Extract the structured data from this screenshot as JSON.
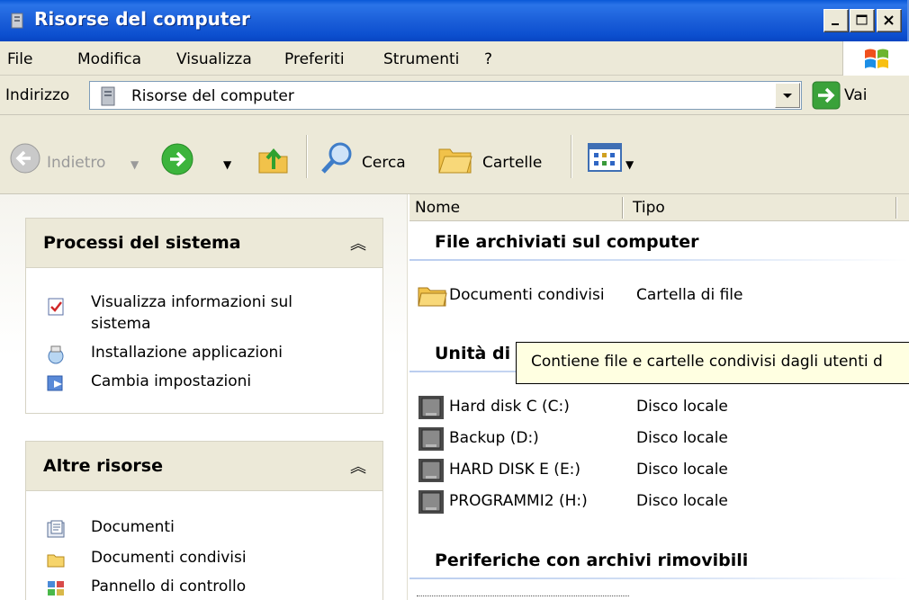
{
  "window": {
    "title": "Risorse del computer"
  },
  "menu": {
    "items": [
      "File",
      "Modifica",
      "Visualizza",
      "Preferiti",
      "Strumenti",
      "?"
    ]
  },
  "address": {
    "label": "Indirizzo",
    "value": "Risorse del computer",
    "go_label": "Vai"
  },
  "toolbar": {
    "back_label": "Indietro",
    "search_label": "Cerca",
    "folders_label": "Cartelle"
  },
  "tasks": {
    "system": {
      "title": "Processi del sistema",
      "items": [
        "Visualizza informazioni sul",
        "sistema",
        "Installazione applicazioni",
        "Cambia impostazioni"
      ]
    },
    "other": {
      "title": "Altre risorse",
      "items": [
        "Documenti",
        "Documenti condivisi",
        "Pannello di controllo"
      ]
    }
  },
  "list": {
    "columns": [
      "Nome",
      "Tipo"
    ],
    "groups": {
      "files": "File archiviati sul computer",
      "drives": "Unità di",
      "removable": "Periferiche con archivi rimovibili"
    },
    "files_rows": [
      {
        "name": "Documenti condivisi",
        "type": "Cartella di file"
      }
    ],
    "drive_rows": [
      {
        "name": "Hard disk C (C:)",
        "type": "Disco locale"
      },
      {
        "name": "Backup (D:)",
        "type": "Disco locale"
      },
      {
        "name": "HARD DISK E (E:)",
        "type": "Disco locale"
      },
      {
        "name": "PROGRAMMI2 (H:)",
        "type": "Disco locale"
      }
    ]
  },
  "tooltip": {
    "text": "Contiene file e cartelle condivisi dagli utenti d"
  },
  "colors": {
    "titlebar": "#0c4fcf",
    "chrome": "#ece9d8",
    "tooltip": "#ffffe1"
  }
}
